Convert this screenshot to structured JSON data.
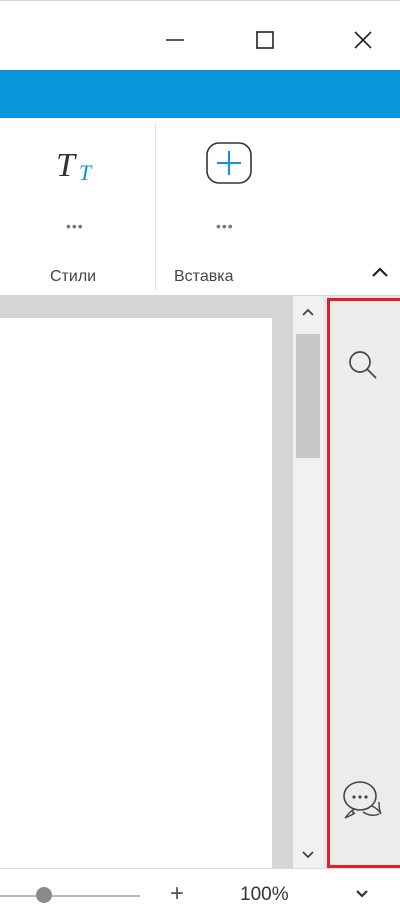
{
  "window": {
    "buttons": [
      {
        "name": "minimize",
        "icon": "minimize-icon"
      },
      {
        "name": "maximize",
        "icon": "maximize-icon"
      },
      {
        "name": "close",
        "icon": "close-icon"
      }
    ]
  },
  "accent_color": "#0a95dd",
  "ribbon": {
    "groups": [
      {
        "label": "Стили",
        "icon": "text-styles-icon",
        "more": "•••"
      },
      {
        "label": "Вставка",
        "icon": "insert-plus-icon",
        "more": "•••"
      }
    ],
    "collapse_icon": "chevron-up-icon"
  },
  "side_panel": {
    "highlight_color": "#e01f2a",
    "icons": [
      "search-icon",
      "comments-icon"
    ]
  },
  "status_bar": {
    "zoom_plus": "+",
    "zoom_level": "100%",
    "zoom_fraction": 0.2
  }
}
